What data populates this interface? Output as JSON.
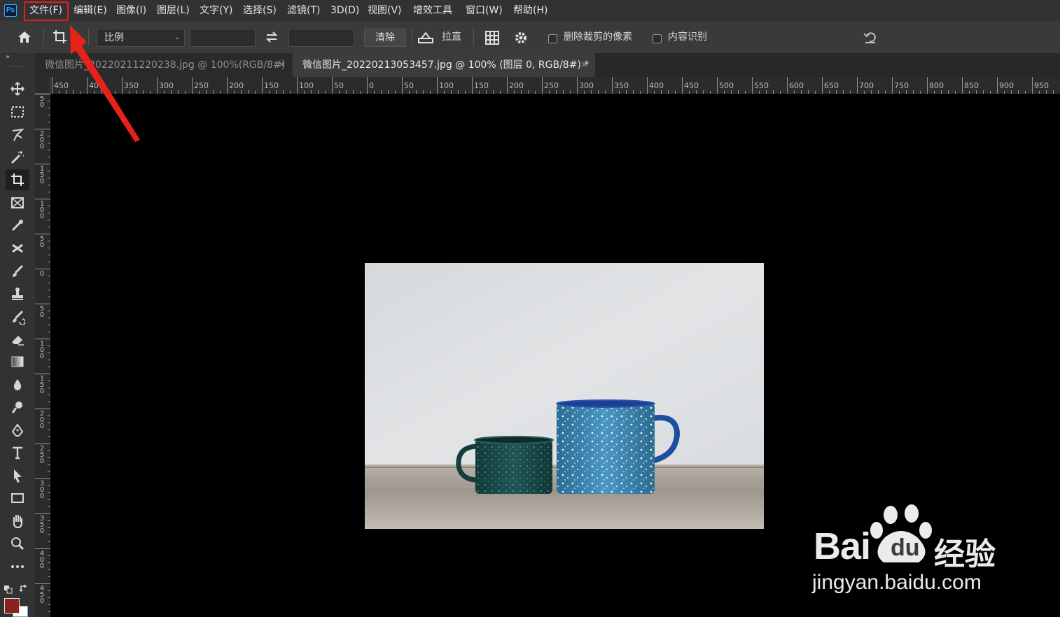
{
  "app": {
    "logo": "Ps"
  },
  "menu": [
    "文件(F)",
    "编辑(E)",
    "图像(I)",
    "图层(L)",
    "文字(Y)",
    "选择(S)",
    "滤镜(T)",
    "3D(D)",
    "视图(V)",
    "增效工具",
    "窗口(W)",
    "帮助(H)"
  ],
  "options": {
    "ratio": "比例",
    "clear": "清除",
    "straighten": "拉直",
    "delete_cropped": "删除裁剪的像素",
    "content_aware": "内容识别"
  },
  "tabs": [
    {
      "label": "微信图片_20220211220238.jpg @ 100%(RGB/8#)",
      "close": "×"
    },
    {
      "label": "微信图片_20220213053457.jpg @ 100% (图层 0, RGB/8#) *",
      "close": "×"
    }
  ],
  "ruler": {
    "h_labels": [
      "450",
      "400",
      "350",
      "300",
      "250",
      "200",
      "150",
      "100",
      "50",
      "0",
      "50",
      "100",
      "150",
      "200",
      "250",
      "300",
      "350",
      "400",
      "450",
      "500",
      "550",
      "600",
      "650",
      "700",
      "750",
      "800",
      "850",
      "900",
      "950"
    ],
    "v_labels": [
      "5\n0",
      "2\n0\n0",
      "1\n5\n0",
      "1\n0\n0",
      "5\n0",
      "0",
      "5\n0",
      "1\n0\n0",
      "1\n5\n0",
      "2\n0\n0",
      "2\n5\n0",
      "3\n0\n0",
      "3\n5\n0",
      "4\n0\n0",
      "4\n5\n0"
    ]
  },
  "colors": {
    "foreground": "#8b2020",
    "background": "#ffffff",
    "highlight": "#e02020"
  },
  "watermark": {
    "brand": "Bai",
    "brand2": "du",
    "cn": "经验",
    "url": "jingyan.baidu.com"
  }
}
